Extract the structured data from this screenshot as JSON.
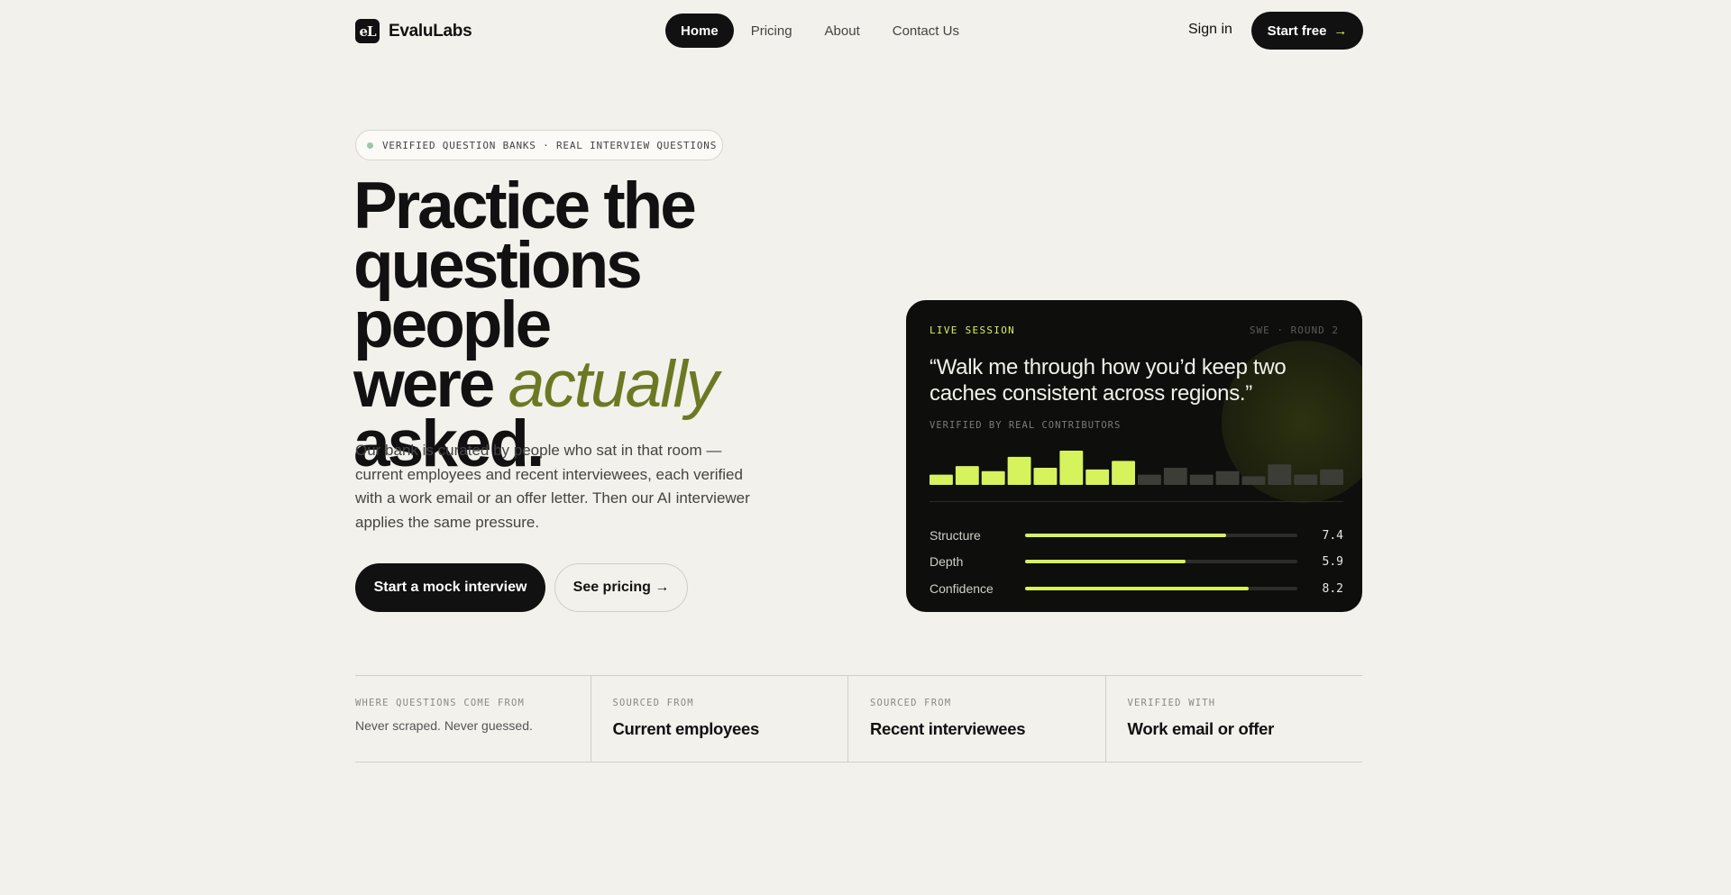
{
  "nav": {
    "logo_text": "eL",
    "brand": "EvaluLabs",
    "links": [
      "Home",
      "Pricing",
      "About",
      "Contact Us"
    ],
    "active_link": "Home",
    "signin": "Sign in",
    "start_free": "Start free",
    "start_free_arrow": "→"
  },
  "hero": {
    "badge": "VERIFIED QUESTION BANKS · REAL INTERVIEW QUESTIONS",
    "headline_line1": "Practice the",
    "headline_line2": "questions people",
    "headline_line3_pre": "were ",
    "headline_accent": "actually",
    "headline_line4": "asked.",
    "lede": "Our bank is curated by people who sat in that room — current employees and recent interviewees, each verified with a work email or an offer letter. Then our AI interviewer applies the same pressure.",
    "cta_primary": "Start a mock interview",
    "cta_secondary": "See pricing →"
  },
  "session_card": {
    "label": "LIVE SESSION",
    "meta": "SWE · ROUND 2",
    "quote": "“Walk me through how you’d keep two caches consistent across regions.”",
    "verified": "VERIFIED BY REAL CONTRIBUTORS",
    "waveform_levels": [
      0.3,
      0.55,
      0.4,
      0.82,
      0.5,
      1.0,
      0.45,
      0.7,
      0.3,
      0.5,
      0.3,
      0.4,
      0.25,
      0.6,
      0.3,
      0.45
    ],
    "waveform_active_count": 8,
    "metrics": [
      {
        "name": "Structure",
        "value": "7.4",
        "fraction": 0.74
      },
      {
        "name": "Depth",
        "value": "5.9",
        "fraction": 0.59
      },
      {
        "name": "Confidence",
        "value": "8.2",
        "fraction": 0.82
      }
    ],
    "colors": {
      "accent": "#d6f25c",
      "inactive_bar": "#3d3d37"
    }
  },
  "strip": {
    "cells": [
      {
        "label": "WHERE QUESTIONS COME FROM",
        "text": "Never scraped. Never guessed."
      },
      {
        "label": "SOURCED FROM",
        "text": "Current employees"
      },
      {
        "label": "SOURCED FROM",
        "text": "Recent interviewees"
      },
      {
        "label": "VERIFIED WITH",
        "text": "Work email or offer"
      }
    ]
  }
}
